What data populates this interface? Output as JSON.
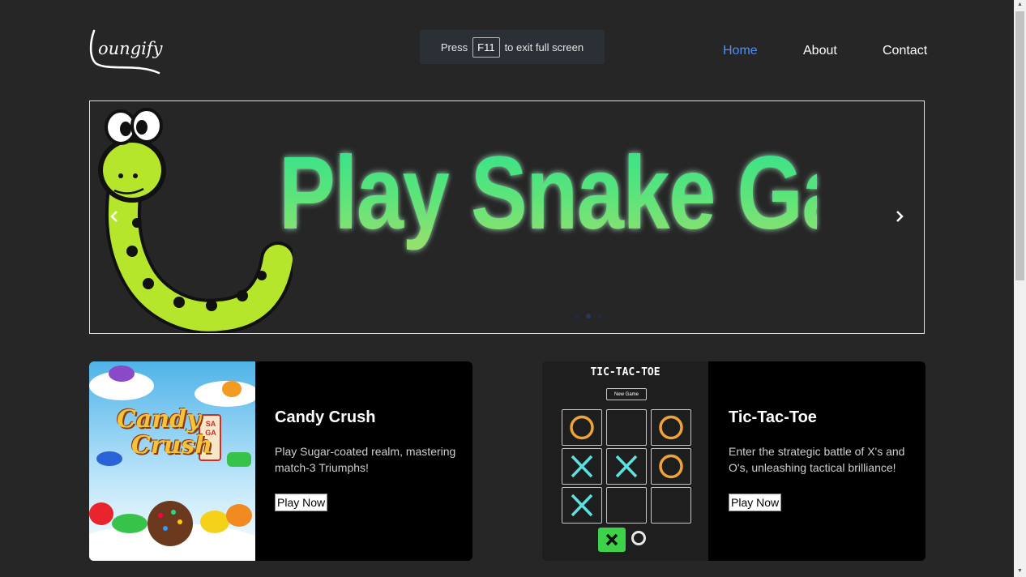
{
  "header": {
    "logo_text": "oungify",
    "nav": [
      {
        "label": "Home",
        "active": true
      },
      {
        "label": "About",
        "active": false
      },
      {
        "label": "Contact",
        "active": false
      }
    ]
  },
  "fullscreen_notice": {
    "prefix": "Press",
    "key": "F11",
    "suffix": "to exit full screen"
  },
  "hero": {
    "title": "Play Snake Game",
    "prev_icon": "chevron-left-icon",
    "next_icon": "chevron-right-icon"
  },
  "cards": [
    {
      "title": "Candy Crush",
      "description": "Play Sugar-coated realm, mastering match-3 Triumphs!",
      "button": "Play Now",
      "image_text": {
        "line1": "Candy",
        "line2": "Crush",
        "badge": "SAGA"
      }
    },
    {
      "title": "Tic-Tac-Toe",
      "description": "Enter the strategic battle of X's and O's, unleashing tactical brilliance!",
      "button": "Play Now",
      "image_text": {
        "heading": "TIC-TAC-TOE",
        "new_game": "New Game"
      },
      "board": [
        "O",
        "",
        "O",
        "X",
        "X",
        "O",
        "X",
        "",
        ""
      ]
    }
  ],
  "colors": {
    "background": "#262626",
    "nav_active": "#4f8ff7",
    "card_bg": "#000000",
    "snake_green": "#b5e62b",
    "ttt_x": "#5fe0e0",
    "ttt_o": "#f0a33a"
  }
}
